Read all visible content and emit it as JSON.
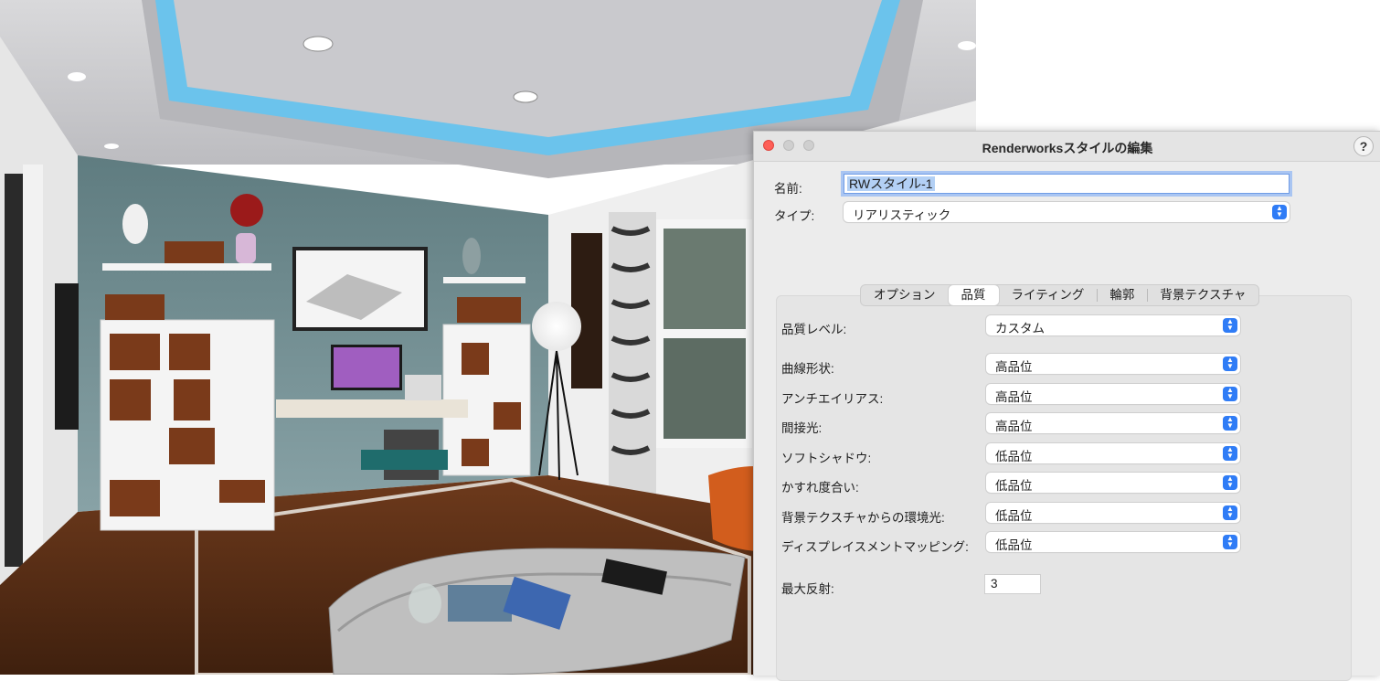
{
  "dialog": {
    "title": "Renderworksスタイルの編集",
    "help_label": "?",
    "name_label": "名前:",
    "name_value": "RWスタイル-1",
    "type_label": "タイプ:",
    "type_value": "リアリスティック"
  },
  "tabs": [
    {
      "label": "オプション",
      "active": false
    },
    {
      "label": "品質",
      "active": true
    },
    {
      "label": "ライティング",
      "active": false
    },
    {
      "label": "輪郭",
      "active": false
    },
    {
      "label": "背景テクスチャ",
      "active": false
    }
  ],
  "quality": {
    "level_label": "品質レベル:",
    "level_value": "カスタム",
    "settings": [
      {
        "label": "曲線形状:",
        "value": "高品位"
      },
      {
        "label": "アンチエイリアス:",
        "value": "高品位"
      },
      {
        "label": "間接光:",
        "value": "高品位"
      },
      {
        "label": "ソフトシャドウ:",
        "value": "低品位"
      },
      {
        "label": "かすれ度合い:",
        "value": "低品位"
      },
      {
        "label": "背景テクスチャからの環境光:",
        "value": "低品位"
      },
      {
        "label": "ディスプレイスメントマッピング:",
        "value": "低品位"
      }
    ],
    "max_reflection_label": "最大反射:",
    "max_reflection_value": "3"
  },
  "colors": {
    "accent": "#2f7cf6",
    "close": "#fe5f57",
    "selection": "#b3d0f5"
  }
}
